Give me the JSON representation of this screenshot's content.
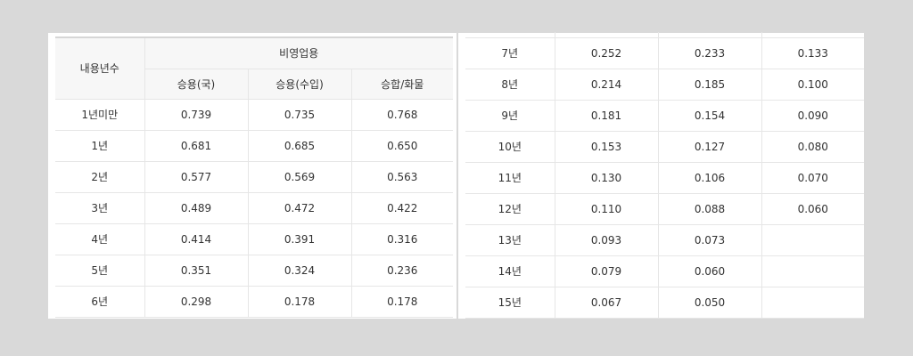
{
  "table": {
    "header": {
      "col_years": "내용년수",
      "group": "비영업용",
      "sub": [
        "승용(국)",
        "승용(수입)",
        "승합/화물"
      ]
    },
    "left_rows": [
      {
        "year": "1년미만",
        "v": [
          "0.739",
          "0.735",
          "0.768"
        ]
      },
      {
        "year": "1년",
        "v": [
          "0.681",
          "0.685",
          "0.650"
        ]
      },
      {
        "year": "2년",
        "v": [
          "0.577",
          "0.569",
          "0.563"
        ]
      },
      {
        "year": "3년",
        "v": [
          "0.489",
          "0.472",
          "0.422"
        ]
      },
      {
        "year": "4년",
        "v": [
          "0.414",
          "0.391",
          "0.316"
        ]
      },
      {
        "year": "5년",
        "v": [
          "0.351",
          "0.324",
          "0.236"
        ]
      },
      {
        "year": "6년",
        "v": [
          "0.298",
          "0.178",
          "0.178"
        ]
      }
    ],
    "right_rows": [
      {
        "year": "7년",
        "v": [
          "0.252",
          "0.233",
          "0.133"
        ]
      },
      {
        "year": "8년",
        "v": [
          "0.214",
          "0.185",
          "0.100"
        ]
      },
      {
        "year": "9년",
        "v": [
          "0.181",
          "0.154",
          "0.090"
        ]
      },
      {
        "year": "10년",
        "v": [
          "0.153",
          "0.127",
          "0.080"
        ]
      },
      {
        "year": "11년",
        "v": [
          "0.130",
          "0.106",
          "0.070"
        ]
      },
      {
        "year": "12년",
        "v": [
          "0.110",
          "0.088",
          "0.060"
        ]
      },
      {
        "year": "13년",
        "v": [
          "0.093",
          "0.073",
          ""
        ]
      },
      {
        "year": "14년",
        "v": [
          "0.079",
          "0.060",
          ""
        ]
      },
      {
        "year": "15년",
        "v": [
          "0.067",
          "0.050",
          ""
        ]
      }
    ]
  }
}
